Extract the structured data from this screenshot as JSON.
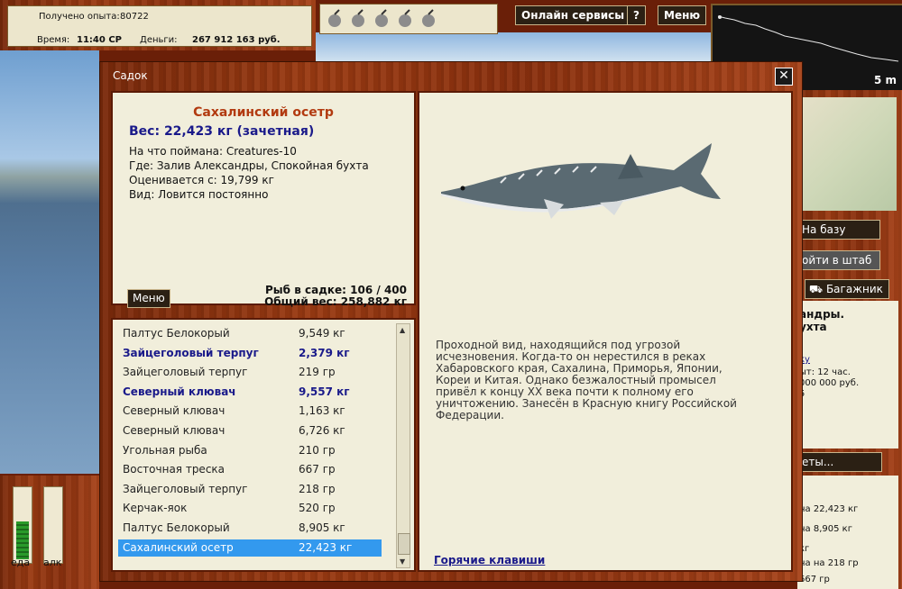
{
  "stats": {
    "experience_label": "Получено опыта:",
    "experience_value": "80722",
    "time_label": "Время:",
    "time_value": "11:40 СР",
    "money_label": "Деньги:",
    "money_value": "267 912 163 руб."
  },
  "header": {
    "online_services": "Онлайн сервисы",
    "help": "?",
    "menu": "Меню"
  },
  "minimap": {
    "depth_label": "5 m"
  },
  "right_panel": {
    "to_base": "На базу",
    "to_hq": "ойти в штаб",
    "trunk": "Багажник",
    "location_line1": "андры.",
    "location_line2": "ухта",
    "link_fragment": "ку",
    "detail1": "ыт: 12 час.",
    "detail2": "000 000 руб.",
    "detail3": "5",
    "results_btn": "еты...",
    "log1": "на 22,423 кг",
    "log2": "на 8,905 кг",
    "log3": "кг",
    "log4": "на на 218 гр",
    "log5": "667 гр"
  },
  "gauges": {
    "food": "еда",
    "alcohol": "алк",
    "food_level": 0.55,
    "alcohol_level": 0.0
  },
  "dialog": {
    "title": "Садок",
    "close": "✕",
    "fish_name": "Сахалинский осетр",
    "weight": "Вес: 22,423 кг (зачетная)",
    "caught_on": "На что поймана: Creatures-10",
    "where": "Где: Залив Александры, Спокойная бухта",
    "valued_from": "Оценивается с: 19,799 кг",
    "kind": "Вид: Ловится постоянно",
    "menu_btn": "Меню",
    "fish_count": "Рыб в садке: 106 / 400",
    "total_weight": "Общий вес: 258,882 кг",
    "description": "Проходной вид, находящийся под угрозой исчезновения.  Когда-то он нерестился в  реках Хабаровского края, Сахалина, Приморья, Японии, Кореи и Китая. Однако безжалостный промысел привёл к концу XX века почти к полному его уничтожению. Занесён в Красную книгу Российской Федерации.",
    "hotkeys": "Горячие клавиши"
  },
  "fish_list": [
    {
      "name": "Палтус Белокорый",
      "weight": "9,549 кг",
      "style": "normal"
    },
    {
      "name": "Зайцеголовый терпуг",
      "weight": "2,379 кг",
      "style": "bold"
    },
    {
      "name": "Зайцеголовый терпуг",
      "weight": "219 гр",
      "style": "normal"
    },
    {
      "name": "Северный клювач",
      "weight": "9,557 кг",
      "style": "bold"
    },
    {
      "name": "Северный клювач",
      "weight": "1,163 кг",
      "style": "normal"
    },
    {
      "name": "Северный клювач",
      "weight": "6,726 кг",
      "style": "normal"
    },
    {
      "name": "Угольная рыба",
      "weight": "210 гр",
      "style": "normal"
    },
    {
      "name": "Восточная треска",
      "weight": "667 гр",
      "style": "normal"
    },
    {
      "name": "Зайцеголовый терпуг",
      "weight": "218 гр",
      "style": "normal"
    },
    {
      "name": "Керчак-яок",
      "weight": "520 гр",
      "style": "normal"
    },
    {
      "name": "Палтус Белокорый",
      "weight": "8,905 кг",
      "style": "normal"
    },
    {
      "name": "Сахалинский осетр",
      "weight": "22,423 кг",
      "style": "selected"
    }
  ],
  "colors": {
    "accent_title": "#b23a10",
    "weight_blue": "#1a1a8a",
    "selection": "#3399ee",
    "wood": "#8a300e"
  }
}
